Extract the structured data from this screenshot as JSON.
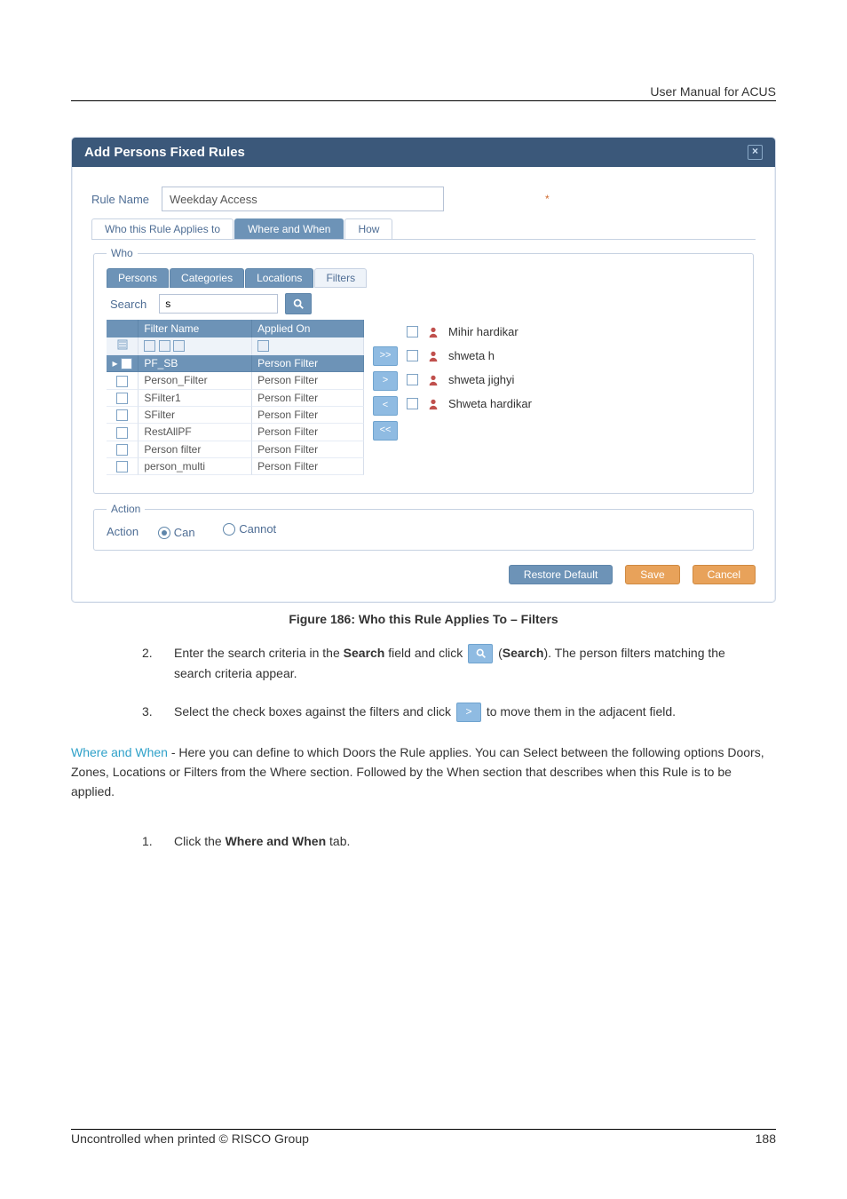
{
  "doc": {
    "header": "User Manual for ACUS",
    "footer_left": "Uncontrolled when printed © RISCO Group",
    "footer_right": "188"
  },
  "dialog": {
    "title": "Add Persons Fixed Rules",
    "rule_name_label": "Rule Name",
    "rule_name_value": "Weekday Access",
    "required": "*",
    "tabs": {
      "who": "Who this Rule Applies to",
      "where": "Where and When",
      "how": "How"
    },
    "who_legend": "Who",
    "sub_tabs": {
      "persons": "Persons",
      "categories": "Categories",
      "locations": "Locations",
      "filters": "Filters"
    },
    "search_label": "Search",
    "search_value": "s",
    "grid": {
      "col_name": "Filter Name",
      "col_applied": "Applied On",
      "rows": [
        {
          "name": "PF_SB",
          "applied": "Person Filter",
          "selected": true
        },
        {
          "name": "Person_Filter",
          "applied": "Person Filter",
          "selected": false
        },
        {
          "name": "SFilter1",
          "applied": "Person Filter",
          "selected": false
        },
        {
          "name": "SFilter",
          "applied": "Person Filter",
          "selected": false
        },
        {
          "name": "RestAllPF",
          "applied": "Person Filter",
          "selected": false
        },
        {
          "name": "Person filter",
          "applied": "Person Filter",
          "selected": false
        },
        {
          "name": "person_multi",
          "applied": "Person Filter",
          "selected": false
        }
      ]
    },
    "transfer": {
      "add_all": ">>",
      "add": ">",
      "remove": "<",
      "remove_all": "<<"
    },
    "persons": [
      "Mihir hardikar",
      "shweta h",
      "shweta jighyi",
      "Shweta hardikar"
    ],
    "action_legend": "Action",
    "action_label": "Action",
    "radio_can": "Can",
    "radio_cannot": "Cannot",
    "btn_restore": "Restore Default",
    "btn_save": "Save",
    "btn_cancel": "Cancel"
  },
  "caption": "Figure 186: Who this Rule Applies To – Filters",
  "steps": {
    "s2_num": "2.",
    "s2a": "Enter the search criteria in the ",
    "s2_search_bold": "Search",
    "s2b": " field and click ",
    "s2c": " (",
    "s2_search_bold2": "Search",
    "s2d": "). The person filters matching the search criteria appear.",
    "s3_num": "3.",
    "s3a": "Select the check boxes against the filters and click ",
    "s3b": " to move them in the adjacent field."
  },
  "section": {
    "heading": "Where and When",
    "body": " - Here you can define to which Doors the Rule applies. You can Select between the following options Doors, Zones, Locations or Filters from the Where section. Followed by the When section that describes when this Rule is to be applied."
  },
  "step1": {
    "num": "1.",
    "a": "Click the ",
    "bold": "Where and When",
    "b": " tab."
  }
}
